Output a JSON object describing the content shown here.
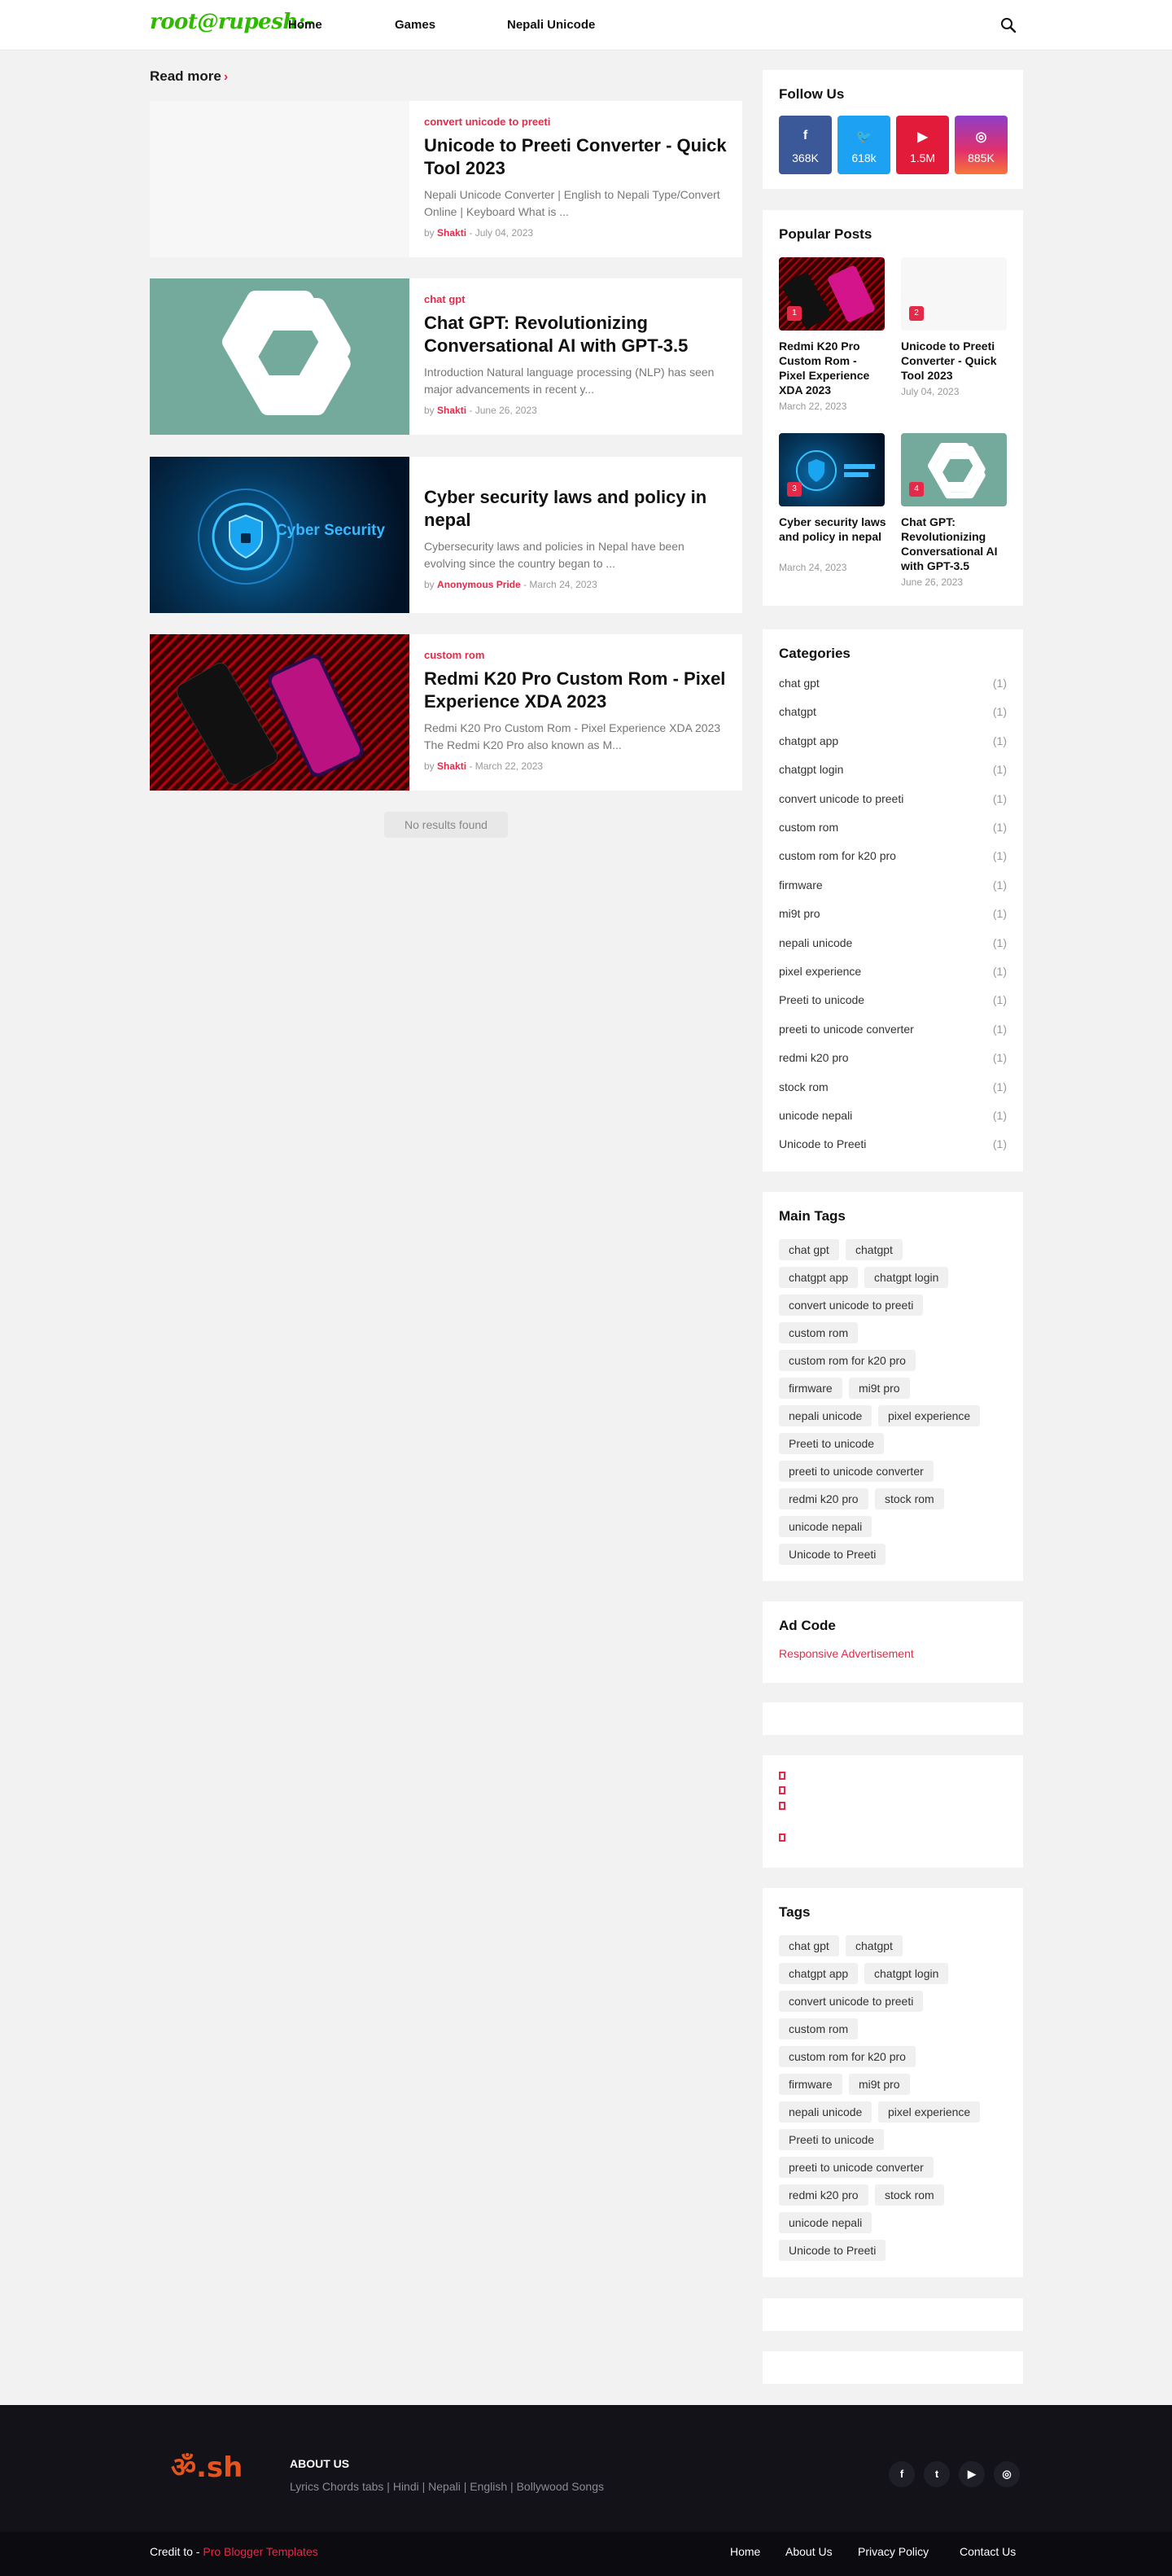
{
  "header": {
    "logo": "root@rupesh:-",
    "nav": [
      "Home",
      "Games",
      "Nepali Unicode"
    ]
  },
  "main": {
    "section_title": "Read more",
    "posts": [
      {
        "label": "convert unicode to preeti",
        "title": "Unicode to Preeti Converter - Quick Tool 2023",
        "snippet": "Nepali Unicode Converter | English to Nepali Type/Convert Online | Keyboard What is ...",
        "by": "by",
        "author": "Shakti",
        "date": "- July 04, 2023"
      },
      {
        "label": "chat gpt",
        "title": "Chat GPT: Revolutionizing Conversational AI with GPT-3.5",
        "snippet": "Introduction  Natural language processing (NLP) has seen major advancements in recent y...",
        "by": "by",
        "author": "Shakti",
        "date": "- June 26, 2023"
      },
      {
        "label": "",
        "title": "Cyber security laws and policy in nepal",
        "snippet": "Cybersecurity laws and policies in Nepal have been evolving since the country began to ...",
        "by": "by",
        "author": "Anonymous Pride",
        "date": "- March 24, 2023",
        "image_text": "Cyber Security"
      },
      {
        "label": "custom rom",
        "title": "Redmi K20 Pro Custom Rom - Pixel Experience XDA 2023",
        "snippet": "Redmi K20 Pro Custom Rom - Pixel Experience XDA 2023 The Redmi K20 Pro also known as M...",
        "by": "by",
        "author": "Shakti",
        "date": "- March 22, 2023"
      }
    ],
    "no_results": "No results found"
  },
  "sidebar": {
    "follow": {
      "title": "Follow Us",
      "items": [
        {
          "icon": "facebook-icon",
          "count": "368K",
          "color": "#3b5998"
        },
        {
          "icon": "twitter-icon",
          "count": "618k",
          "color": "#1da1f2"
        },
        {
          "icon": "youtube-icon",
          "count": "1.5M",
          "color": "#e21b3b"
        },
        {
          "icon": "instagram-icon",
          "count": "885K",
          "color": "#c13584"
        }
      ]
    },
    "popular": {
      "title": "Popular Posts",
      "items": [
        {
          "num": "1",
          "title": "Redmi K20 Pro Custom Rom - Pixel Experience XDA 2023",
          "date": "March 22, 2023"
        },
        {
          "num": "2",
          "title": "Unicode to Preeti Converter - Quick Tool 2023",
          "date": "July 04, 2023"
        },
        {
          "num": "3",
          "title": "Cyber security laws and policy in nepal",
          "date": "March 24, 2023"
        },
        {
          "num": "4",
          "title": "Chat GPT: Revolutionizing Conversational AI with GPT-3.5",
          "date": "June 26, 2023"
        }
      ]
    },
    "categories": {
      "title": "Categories",
      "items": [
        {
          "name": "chat gpt",
          "count": "(1)"
        },
        {
          "name": "chatgpt",
          "count": "(1)"
        },
        {
          "name": "chatgpt app",
          "count": "(1)"
        },
        {
          "name": "chatgpt login",
          "count": "(1)"
        },
        {
          "name": "convert unicode to preeti",
          "count": "(1)"
        },
        {
          "name": "custom rom",
          "count": "(1)"
        },
        {
          "name": "custom rom for k20 pro",
          "count": "(1)"
        },
        {
          "name": "firmware",
          "count": "(1)"
        },
        {
          "name": "mi9t pro",
          "count": "(1)"
        },
        {
          "name": "nepali unicode",
          "count": "(1)"
        },
        {
          "name": "pixel experience",
          "count": "(1)"
        },
        {
          "name": "Preeti to unicode",
          "count": "(1)"
        },
        {
          "name": "preeti to unicode converter",
          "count": "(1)"
        },
        {
          "name": "redmi k20 pro",
          "count": "(1)"
        },
        {
          "name": "stock rom",
          "count": "(1)"
        },
        {
          "name": "unicode nepali",
          "count": "(1)"
        },
        {
          "name": "Unicode to Preeti",
          "count": "(1)"
        }
      ]
    },
    "main_tags": {
      "title": "Main Tags",
      "rows": [
        [
          "chat gpt",
          "chatgpt"
        ],
        [
          "chatgpt app",
          "chatgpt login"
        ],
        [
          "convert unicode to preeti"
        ],
        [
          "custom rom"
        ],
        [
          "custom rom for k20 pro"
        ],
        [
          "firmware",
          "mi9t pro"
        ],
        [
          "nepali unicode",
          "pixel experience"
        ],
        [
          "Preeti to unicode"
        ],
        [
          "preeti to unicode converter"
        ],
        [
          "redmi k20 pro",
          "stock rom"
        ],
        [
          "unicode nepali"
        ],
        [
          "Unicode to Preeti"
        ]
      ]
    },
    "ad": {
      "title": "Ad Code",
      "link": "Responsive Advertisement"
    },
    "tags": {
      "title": "Tags",
      "rows": [
        [
          "chat gpt",
          "chatgpt"
        ],
        [
          "chatgpt app",
          "chatgpt login"
        ],
        [
          "convert unicode to preeti"
        ],
        [
          "custom rom"
        ],
        [
          "custom rom for k20 pro"
        ],
        [
          "firmware",
          "mi9t pro"
        ],
        [
          "nepali unicode",
          "pixel experience"
        ],
        [
          "Preeti to unicode"
        ],
        [
          "preeti to unicode converter"
        ],
        [
          "redmi k20 pro",
          "stock rom"
        ],
        [
          "unicode nepali"
        ],
        [
          "Unicode to Preeti"
        ]
      ]
    }
  },
  "footer": {
    "logo": "ॐ.sh",
    "about_title": "ABOUT US",
    "about_text": "Lyrics Chords tabs | Hindi | Nepali | English | Bollywood Songs",
    "social": [
      "facebook-icon",
      "twitter-icon",
      "youtube-icon",
      "instagram-icon"
    ],
    "credit_prefix": "Credit to -",
    "credit_link": "Pro Blogger Templates",
    "links": [
      "Home",
      "About Us",
      "Privacy Policy",
      "Contact Us"
    ]
  },
  "colors": {
    "accent": "#e52a49",
    "logo": "#2fb900",
    "footer": "#121218"
  }
}
